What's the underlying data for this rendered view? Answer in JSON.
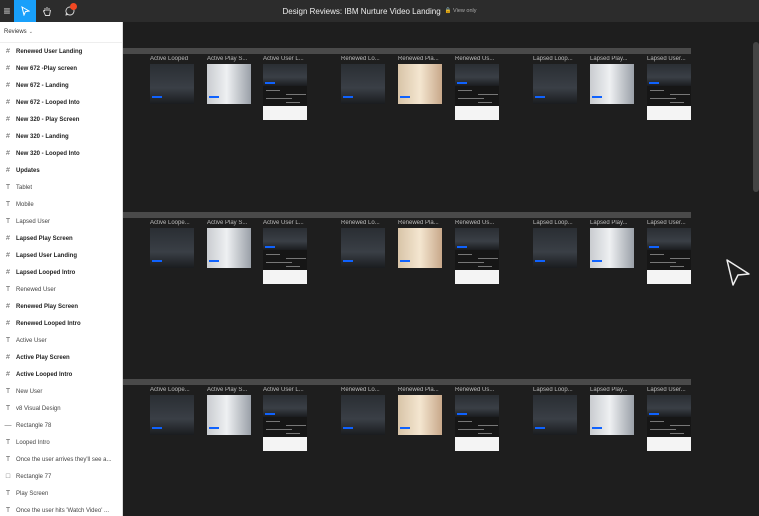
{
  "window": {
    "title": "Design Reviews: IBM Nurture Video Landing",
    "view_mode": "View only"
  },
  "toolbar": {
    "menu_icon": "≡",
    "move_icon": "▷",
    "hand_icon": "✋",
    "comment_icon": "💬"
  },
  "sidebar": {
    "page_selector": "Reviews",
    "layers": [
      {
        "label": "Renewed User Landing",
        "type": "frame"
      },
      {
        "label": "New 672 -Play screen",
        "type": "frame"
      },
      {
        "label": "New 672 - Landing",
        "type": "frame"
      },
      {
        "label": "New 672 - Looped Into",
        "type": "frame"
      },
      {
        "label": "New 320 - Play Screen",
        "type": "frame"
      },
      {
        "label": "New 320 - Landing",
        "type": "frame"
      },
      {
        "label": "New 320 - Looped Into",
        "type": "frame"
      },
      {
        "label": "Updates",
        "type": "frame"
      },
      {
        "label": "Tablet",
        "type": "text"
      },
      {
        "label": "Mobile",
        "type": "text"
      },
      {
        "label": "Lapsed User",
        "type": "text"
      },
      {
        "label": "Lapsed Play Screen",
        "type": "frame"
      },
      {
        "label": "Lapsed User Landing",
        "type": "frame"
      },
      {
        "label": "Lapsed Looped Intro",
        "type": "frame"
      },
      {
        "label": "Renewed User",
        "type": "text"
      },
      {
        "label": "Renewed Play Screen",
        "type": "frame"
      },
      {
        "label": "Renewed Looped Intro",
        "type": "frame"
      },
      {
        "label": "Active User",
        "type": "text"
      },
      {
        "label": "Active Play Screen",
        "type": "frame"
      },
      {
        "label": "Active Looped Intro",
        "type": "frame"
      },
      {
        "label": "New User",
        "type": "text"
      },
      {
        "label": "v8 Visual Design",
        "type": "text"
      },
      {
        "label": "Rectangle 78",
        "type": "line"
      },
      {
        "label": "Looped Intro",
        "type": "text"
      },
      {
        "label": "Once the user arrives they'll see a...",
        "type": "text"
      },
      {
        "label": "Rectangle 77",
        "type": "rect"
      },
      {
        "label": "Play Screen",
        "type": "text"
      },
      {
        "label": "Once the user hits 'Watch Video' ...",
        "type": "text"
      }
    ]
  },
  "canvas": {
    "rows": [
      {
        "frames": [
          {
            "label": "Active Looped",
            "style": "dark",
            "tall": false
          },
          {
            "label": "Active Play S...",
            "style": "light",
            "tall": false
          },
          {
            "label": "Active User L...",
            "style": "dark",
            "tall": true
          },
          {
            "label": "Renewed Lo...",
            "style": "dark",
            "tall": false
          },
          {
            "label": "Renewed Pla...",
            "style": "warm",
            "tall": false
          },
          {
            "label": "Renewed Us...",
            "style": "dark",
            "tall": true
          },
          {
            "label": "Lapsed Loop...",
            "style": "dark",
            "tall": false
          },
          {
            "label": "Lapsed Play...",
            "style": "light",
            "tall": false
          },
          {
            "label": "Lapsed User...",
            "style": "dark",
            "tall": true
          }
        ]
      },
      {
        "frames": [
          {
            "label": "Active Loope...",
            "style": "dark",
            "tall": false
          },
          {
            "label": "Active Play S...",
            "style": "light",
            "tall": false
          },
          {
            "label": "Active User L...",
            "style": "dark",
            "tall": true
          },
          {
            "label": "Renewed Lo...",
            "style": "dark",
            "tall": false
          },
          {
            "label": "Renewed Pla...",
            "style": "warm",
            "tall": false
          },
          {
            "label": "Renewed Us...",
            "style": "dark",
            "tall": true
          },
          {
            "label": "Lapsed Loop...",
            "style": "dark",
            "tall": false
          },
          {
            "label": "Lapsed Play...",
            "style": "light",
            "tall": false
          },
          {
            "label": "Lapsed User...",
            "style": "dark",
            "tall": true
          }
        ]
      },
      {
        "frames": [
          {
            "label": "Active Loope...",
            "style": "dark",
            "tall": false
          },
          {
            "label": "Active Play S...",
            "style": "light",
            "tall": false
          },
          {
            "label": "Active User L...",
            "style": "dark",
            "tall": true
          },
          {
            "label": "Renewed Lo...",
            "style": "dark",
            "tall": false
          },
          {
            "label": "Renewed Pla...",
            "style": "warm",
            "tall": false
          },
          {
            "label": "Renewed Us...",
            "style": "dark",
            "tall": true
          },
          {
            "label": "Lapsed Loop...",
            "style": "dark",
            "tall": false
          },
          {
            "label": "Lapsed Play...",
            "style": "light",
            "tall": false
          },
          {
            "label": "Lapsed User...",
            "style": "dark",
            "tall": true
          }
        ]
      }
    ]
  },
  "colors": {
    "accent": "#18a0fb",
    "notification": "#f24822",
    "canvas": "#1e1e1e",
    "ibm_blue": "#0f62fe"
  }
}
